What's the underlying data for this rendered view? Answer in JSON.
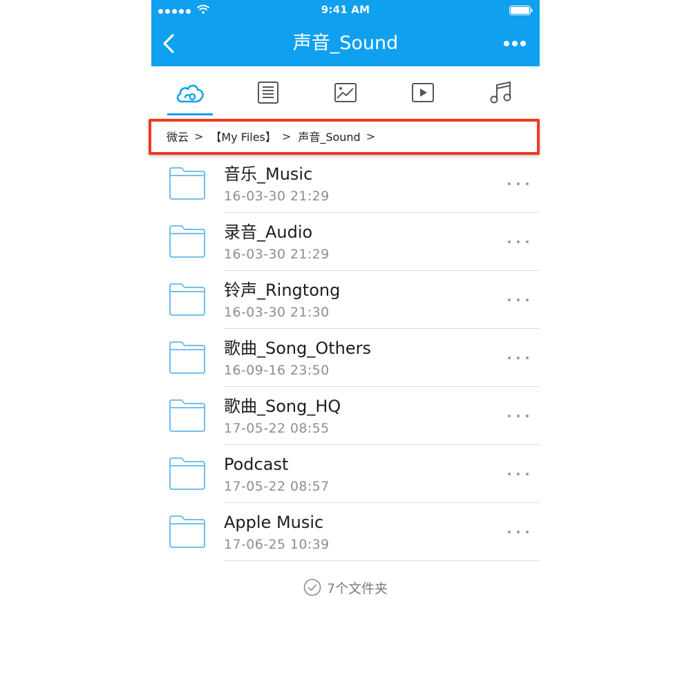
{
  "status_bar": {
    "time": "9:41 AM",
    "signal_icon": "signal-dots-icon",
    "wifi_icon": "wifi-icon",
    "battery_icon": "battery-icon"
  },
  "nav": {
    "back_icon": "chevron-left-icon",
    "title": "声音_Sound",
    "more_icon": "more-horizontal-icon"
  },
  "colors": {
    "accent": "#0fa0ef",
    "highlight_border": "#f23a20",
    "folder_stroke": "#5fb7ea",
    "icon_gray": "#555555"
  },
  "tabs": [
    {
      "icon": "cloud-icon",
      "active": true
    },
    {
      "icon": "document-icon",
      "active": false
    },
    {
      "icon": "image-icon",
      "active": false
    },
    {
      "icon": "video-icon",
      "active": false
    },
    {
      "icon": "music-icon",
      "active": false
    }
  ],
  "breadcrumb": {
    "items": [
      "微云",
      "【My Files】",
      "声音_Sound"
    ],
    "separator": ">"
  },
  "files": [
    {
      "name": "音乐_Music",
      "date": "16-03-30 21:29",
      "icon": "folder-icon"
    },
    {
      "name": "录音_Audio",
      "date": "16-03-30 21:29",
      "icon": "folder-icon"
    },
    {
      "name": "铃声_Ringtong",
      "date": "16-03-30 21:30",
      "icon": "folder-icon"
    },
    {
      "name": "歌曲_Song_Others",
      "date": "16-09-16 23:50",
      "icon": "folder-icon"
    },
    {
      "name": "歌曲_Song_HQ",
      "date": "17-05-22 08:55",
      "icon": "folder-icon"
    },
    {
      "name": "Podcast",
      "date": "17-05-22 08:57",
      "icon": "folder-icon"
    },
    {
      "name": "Apple Music",
      "date": "17-06-25 10:39",
      "icon": "folder-icon"
    }
  ],
  "footer": {
    "icon": "check-circle-icon",
    "count_text": "7个文件夹"
  }
}
